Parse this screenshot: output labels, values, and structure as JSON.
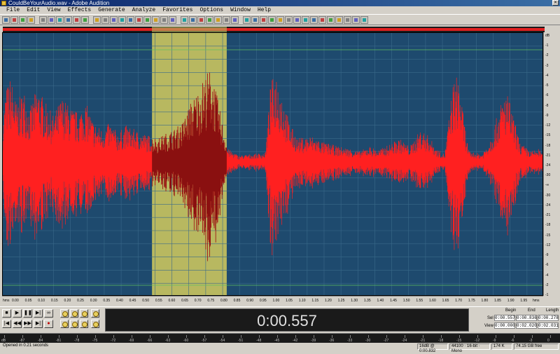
{
  "window": {
    "title": "CouldBeYourAudio.wav - Adobe Audition"
  },
  "menu": [
    {
      "label": "File"
    },
    {
      "label": "Edit"
    },
    {
      "label": "View"
    },
    {
      "label": "Effects"
    },
    {
      "label": "Generate"
    },
    {
      "label": "Analyze"
    },
    {
      "label": "Favorites"
    },
    {
      "label": "Options"
    },
    {
      "label": "Window"
    },
    {
      "label": "Help"
    }
  ],
  "toolbar_icons": [
    "multitrack-icon",
    "open-icon",
    "save-icon",
    "close-file-icon",
    "cut-icon",
    "copy-icon",
    "paste-icon",
    "mix-paste-icon",
    "undo-icon",
    "redo-icon",
    "repeat-icon",
    "spectral-view-icon",
    "waveform-view-icon",
    "snap-icon",
    "settings-icon",
    "cd-icon",
    "loop-icon",
    "metronome-icon",
    "marker-icon",
    "envelope-icon",
    "zoom-tool-icon",
    "time-select-icon",
    "marquee-icon",
    "lasso-icon",
    "scrub-icon",
    "brush-icon",
    "effects-icon",
    "amplify-icon",
    "normalize-icon",
    "reverb-icon",
    "delay-icon",
    "eq-icon",
    "noise-icon",
    "pitch-icon",
    "stretch-icon",
    "analysis-icon",
    "frequency-icon",
    "phase-icon",
    "batch-icon",
    "script-icon",
    "cd-burn-icon",
    "help-icon"
  ],
  "waveform": {
    "selection_start": 0.557,
    "selection_end": 0.836,
    "view_start": 0.0,
    "view_end": 2.02,
    "waveform_color": "#ff2020",
    "background_color": "#1e4a6e",
    "selection_color": "#b8b860"
  },
  "time_ruler": {
    "unit": "hms",
    "ticks": [
      "0.00",
      "0.05",
      "0.10",
      "0.15",
      "0.20",
      "0.25",
      "0.30",
      "0.35",
      "0.40",
      "0.45",
      "0.50",
      "0.55",
      "0.60",
      "0.65",
      "0.70",
      "0.75",
      "0.80",
      "0.85",
      "0.90",
      "0.95",
      "1.00",
      "1.05",
      "1.10",
      "1.15",
      "1.20",
      "1.25",
      "1.30",
      "1.35",
      "1.40",
      "1.45",
      "1.50",
      "1.55",
      "1.60",
      "1.65",
      "1.70",
      "1.75",
      "1.80",
      "1.85",
      "1.90",
      "1.95"
    ]
  },
  "db_ruler": {
    "ticks": [
      "dB",
      "-1",
      "-2",
      "-3",
      "-4",
      "-5",
      "-6",
      "-8",
      "-9",
      "-12",
      "-15",
      "-18",
      "-21",
      "-24",
      "-30",
      "-∞",
      "-30",
      "-24",
      "-21",
      "-18",
      "-15",
      "-12",
      "-9",
      "-6",
      "-4",
      "-2",
      "-1"
    ]
  },
  "transport": {
    "buttons": [
      "stop",
      "play",
      "pause",
      "play-to-end",
      "loop",
      "go-start",
      "rewind",
      "fast-forward",
      "go-end",
      "record"
    ]
  },
  "time_display": {
    "value": "0:00.557"
  },
  "selection_view": {
    "headers": {
      "begin": "Begin",
      "end": "End",
      "length": "Length"
    },
    "sel_label": "Sel",
    "view_label": "View",
    "sel": {
      "begin": "0:00.557",
      "end": "0:00.836",
      "length": "0:00.278"
    },
    "view": {
      "begin": "0:00.000",
      "end": "0:02.020",
      "length": "0:02.031"
    }
  },
  "level_meter": {
    "ticks": [
      "dB",
      "-87",
      "-84",
      "-81",
      "-78",
      "-75",
      "-72",
      "-69",
      "-66",
      "-63",
      "-60",
      "-57",
      "-54",
      "-51",
      "-48",
      "-45",
      "-42",
      "-39",
      "-36",
      "-33",
      "-30",
      "-27",
      "-24",
      "-21",
      "-18",
      "-15",
      "-12",
      "-9",
      "-6",
      "-3",
      "0"
    ]
  },
  "statusbar": {
    "message": "Opened in 0.21 seconds",
    "bits": "16dB @ 0:00.832",
    "format": "44100 · 16-bit · Mono",
    "size": "174 K",
    "free": "74.15 GB free"
  }
}
